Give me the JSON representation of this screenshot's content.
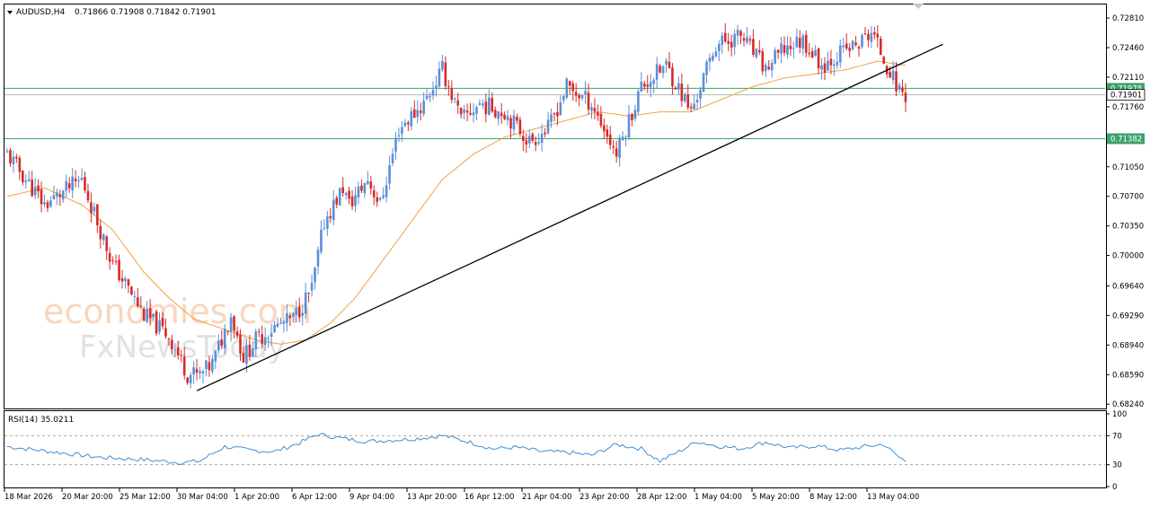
{
  "header": {
    "symbol_label": "AUDUSD,H4",
    "ohlc": "0.71866 0.71908 0.71842 0.71901"
  },
  "watermark": {
    "line1": "economies.com",
    "line2": "FxNewsToday"
  },
  "chart_data": [
    {
      "type": "candlestick",
      "symbol": "AUDUSD",
      "timeframe": "H4",
      "y_axis_ticks": [
        "0.72810",
        "0.72460",
        "0.72110",
        "0.71760",
        "0.71050",
        "0.70700",
        "0.70350",
        "0.70000",
        "0.69640",
        "0.69290",
        "0.68940",
        "0.68590",
        "0.68240"
      ],
      "ylim": [
        0.682,
        0.7296
      ],
      "x_axis_ticks": [
        "18 Mar 2026",
        "20 Mar 20:00",
        "25 Mar 12:00",
        "30 Mar 04:00",
        "1 Apr 20:00",
        "6 Apr 12:00",
        "9 Apr 04:00",
        "13 Apr 20:00",
        "16 Apr 12:00",
        "21 Apr 04:00",
        "23 Apr 20:00",
        "28 Apr 12:00",
        "1 May 04:00",
        "5 May 20:00",
        "8 May 12:00",
        "13 May 04:00"
      ],
      "price_path": [
        [
          0,
          0.712
        ],
        [
          12,
          0.706
        ],
        [
          24,
          0.709
        ],
        [
          34,
          0.699
        ],
        [
          44,
          0.693
        ],
        [
          52,
          0.6905
        ],
        [
          58,
          0.686
        ],
        [
          62,
          0.6858
        ],
        [
          66,
          0.6872
        ],
        [
          72,
          0.693
        ],
        [
          76,
          0.688
        ],
        [
          80,
          0.69
        ],
        [
          86,
          0.6915
        ],
        [
          92,
          0.6925
        ],
        [
          98,
          0.696
        ],
        [
          102,
          0.704
        ],
        [
          108,
          0.708
        ],
        [
          110,
          0.706
        ],
        [
          116,
          0.709
        ],
        [
          120,
          0.706
        ],
        [
          126,
          0.715
        ],
        [
          134,
          0.718
        ],
        [
          140,
          0.722
        ],
        [
          146,
          0.716
        ],
        [
          152,
          0.718
        ],
        [
          160,
          0.717
        ],
        [
          168,
          0.7135
        ],
        [
          174,
          0.715
        ],
        [
          180,
          0.72
        ],
        [
          188,
          0.718
        ],
        [
          196,
          0.712
        ],
        [
          204,
          0.72
        ],
        [
          212,
          0.7225
        ],
        [
          220,
          0.717
        ],
        [
          228,
          0.725
        ],
        [
          236,
          0.726
        ],
        [
          244,
          0.722
        ],
        [
          250,
          0.7245
        ],
        [
          256,
          0.7255
        ],
        [
          262,
          0.7225
        ],
        [
          268,
          0.724
        ],
        [
          274,
          0.725
        ],
        [
          278,
          0.7265
        ],
        [
          283,
          0.7225
        ],
        [
          286,
          0.7201
        ],
        [
          289,
          0.719
        ]
      ],
      "moving_average": [
        [
          0,
          0.707
        ],
        [
          12,
          0.708
        ],
        [
          24,
          0.706
        ],
        [
          34,
          0.703
        ],
        [
          44,
          0.698
        ],
        [
          52,
          0.695
        ],
        [
          60,
          0.6925
        ],
        [
          72,
          0.691
        ],
        [
          80,
          0.69
        ],
        [
          88,
          0.6895
        ],
        [
          96,
          0.69
        ],
        [
          104,
          0.692
        ],
        [
          112,
          0.695
        ],
        [
          120,
          0.699
        ],
        [
          130,
          0.704
        ],
        [
          140,
          0.709
        ],
        [
          150,
          0.712
        ],
        [
          160,
          0.714
        ],
        [
          170,
          0.715
        ],
        [
          180,
          0.716
        ],
        [
          190,
          0.717
        ],
        [
          200,
          0.7165
        ],
        [
          210,
          0.717
        ],
        [
          220,
          0.717
        ],
        [
          230,
          0.7185
        ],
        [
          240,
          0.72
        ],
        [
          250,
          0.721
        ],
        [
          260,
          0.7215
        ],
        [
          270,
          0.722
        ],
        [
          280,
          0.723
        ],
        [
          289,
          0.7225
        ]
      ],
      "trendline": {
        "from": [
          61,
          0.684
        ],
        "to": [
          301,
          0.725
        ]
      },
      "horizontal_levels": [
        {
          "value": 0.71978,
          "label": "0.71978",
          "color": "#3da36a"
        },
        {
          "value": 0.71382,
          "label": "0.71382",
          "color": "#3da36a"
        }
      ],
      "current_price": {
        "value": 0.71901,
        "label": "0.71901"
      },
      "colors": {
        "bull": "#5b8fd6",
        "bear": "#d62b2b",
        "ma": "#f2a143",
        "trend": "#000000"
      }
    },
    {
      "type": "line",
      "indicator_label": "RSI(14) 35.0211",
      "ylim": [
        0,
        100
      ],
      "levels": [
        70,
        30
      ],
      "y_axis_ticks": [
        "100",
        "70",
        "30",
        "0"
      ],
      "path": [
        [
          0,
          55
        ],
        [
          10,
          50
        ],
        [
          20,
          45
        ],
        [
          30,
          40
        ],
        [
          40,
          38
        ],
        [
          50,
          35
        ],
        [
          56,
          33
        ],
        [
          62,
          35
        ],
        [
          70,
          55
        ],
        [
          78,
          50
        ],
        [
          86,
          48
        ],
        [
          94,
          60
        ],
        [
          100,
          72
        ],
        [
          108,
          66
        ],
        [
          116,
          62
        ],
        [
          124,
          64
        ],
        [
          132,
          66
        ],
        [
          140,
          70
        ],
        [
          148,
          62
        ],
        [
          156,
          52
        ],
        [
          164,
          54
        ],
        [
          172,
          48
        ],
        [
          180,
          47
        ],
        [
          188,
          43
        ],
        [
          196,
          58
        ],
        [
          204,
          52
        ],
        [
          210,
          35
        ],
        [
          216,
          48
        ],
        [
          222,
          62
        ],
        [
          228,
          56
        ],
        [
          236,
          52
        ],
        [
          244,
          61
        ],
        [
          252,
          53
        ],
        [
          260,
          56
        ],
        [
          268,
          50
        ],
        [
          276,
          55
        ],
        [
          282,
          58
        ],
        [
          287,
          40
        ],
        [
          289,
          35
        ]
      ],
      "color": "#3d8fd6"
    }
  ]
}
